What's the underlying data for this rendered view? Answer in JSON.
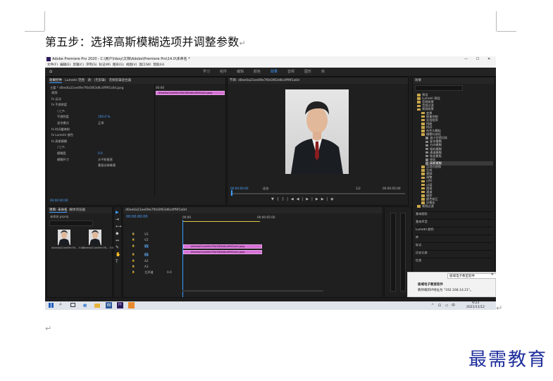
{
  "document": {
    "heading": "第五步：选择高斯模糊选项并调整参数",
    "paragraph_mark": "↵"
  },
  "premiere": {
    "title": "Adobe Premiere Pro 2020 - C:\\用户\\hboy\\文档\\Adobe\\Premiere Pro\\14.0\\未命名 *",
    "window_controls": [
      "—",
      "☐",
      "✕"
    ],
    "menu": [
      "文件(F)",
      "编辑(E)",
      "剪辑(C)",
      "序列(S)",
      "标记(M)",
      "图形(G)",
      "视图(V)",
      "窗口(W)",
      "帮助(H)"
    ],
    "workspaces": [
      "学习",
      "组件",
      "编辑",
      "颜色",
      "效果",
      "音频",
      "图形",
      "库"
    ],
    "active_workspace": "效果",
    "effect_controls": {
      "tabs": [
        "效果控件",
        "Lumetri 范围",
        "源：(无剪辑)",
        "音频剪辑混合器"
      ],
      "master_label": "主要 * d0ee0a21ee09e7f0d3f63d6c4ff9f1a0d.jpeg",
      "clip_label": "d0ee0a21ee09e7f0d3f63d6c4ff9f1a0d.jpeg",
      "timecode": "00:00",
      "rows": [
        {
          "label": "视频",
          "value": ""
        },
        {
          "label": "fx  运动",
          "value": ""
        },
        {
          "label": "fx  不透明度",
          "value": ""
        },
        {
          "label": "○□✎",
          "value": ""
        },
        {
          "label": "不透明度",
          "value": "100.0 %"
        },
        {
          "label": "混合模式",
          "value": "正常"
        },
        {
          "label": "fx  时间重映射",
          "value": ""
        },
        {
          "label": "fx  Lumetri 颜色",
          "value": ""
        },
        {
          "label": "fx  高斯模糊",
          "value": ""
        },
        {
          "label": "○□✎",
          "value": ""
        },
        {
          "label": "模糊度",
          "value": "0.0"
        },
        {
          "label": "模糊尺寸",
          "value": "水平和垂直"
        },
        {
          "label": "",
          "value": "重复边缘像素"
        }
      ],
      "bottom_time": "00:00:00:00"
    },
    "program": {
      "title": "节目: d0ee0a21ee09e7f0d3f63d6c4ff9f1a0d",
      "timecode": "00:00:00:00",
      "fit": "适合",
      "fraction": "1/2",
      "duration": "00:00:05:00"
    },
    "effects_panel": {
      "title": "效果",
      "items": [
        {
          "label": "预设",
          "level": 0
        },
        {
          "label": "Lumetri 预设",
          "level": 0
        },
        {
          "label": "音频效果",
          "level": 0
        },
        {
          "label": "音频过渡",
          "level": 0
        },
        {
          "label": "视频效果",
          "level": 0
        },
        {
          "label": "变换",
          "level": 1
        },
        {
          "label": "图像控制",
          "level": 1
        },
        {
          "label": "实用程序",
          "level": 1
        },
        {
          "label": "扭曲",
          "level": 1
        },
        {
          "label": "时间",
          "level": 1
        },
        {
          "label": "杂色与颗粒",
          "level": 1
        },
        {
          "label": "模糊与锐化",
          "level": 1
        },
        {
          "label": "减少交错闪烁",
          "level": 2
        },
        {
          "label": "复合模糊",
          "level": 2
        },
        {
          "label": "方向模糊",
          "level": 2
        },
        {
          "label": "相机模糊",
          "level": 2
        },
        {
          "label": "通道模糊",
          "level": 2
        },
        {
          "label": "钝化蒙版",
          "level": 2
        },
        {
          "label": "锐化",
          "level": 2
        },
        {
          "label": "高斯模糊",
          "level": 2,
          "selected": true
        },
        {
          "label": "沉浸式视频",
          "level": 1
        },
        {
          "label": "生成",
          "level": 1
        },
        {
          "label": "视频",
          "level": 1
        },
        {
          "label": "调整",
          "level": 1
        },
        {
          "label": "过时",
          "level": 1
        },
        {
          "label": "过渡",
          "level": 1
        },
        {
          "label": "透视",
          "level": 1
        },
        {
          "label": "通道",
          "level": 1
        },
        {
          "label": "键控",
          "level": 1
        },
        {
          "label": "颜色校正",
          "level": 1
        },
        {
          "label": "风格化",
          "level": 1
        },
        {
          "label": "视频过渡",
          "level": 0
        }
      ],
      "footer": [
        "基本图形",
        "基本声音",
        "Lumetri 颜色",
        "库",
        "标记",
        "历史记录",
        "信息"
      ]
    },
    "project": {
      "tabs": [
        "项目: 未命名",
        "媒体浏览器"
      ],
      "file": "未命名.prproj",
      "items": [
        {
          "name": "d0ee0a21ee09e7f0...",
          "dur": "5:00"
        },
        {
          "name": "d0ee0a21ee09e7f0...",
          "dur": "5:00"
        }
      ]
    },
    "timeline": {
      "title": "d0ee0a21ee09e7f0d3f63d6c4ff9f1a0d",
      "timecode": "00:00:00:00",
      "ruler": [
        "00:00",
        "00:00:05:00"
      ],
      "tracks": [
        "V3",
        "V2",
        "V1",
        "A1",
        "A2",
        "A3",
        "主声道"
      ],
      "master_value": "0.0",
      "clips": [
        {
          "label": "d0ee0a21ee09e7f0d3f63d6c4ff9f1a0d.jpeg",
          "track": "V2"
        },
        {
          "label": "d0ee0a21ee09e7f0d3f63d6c4ff9f1a0d.jpeg",
          "track": "V1"
        }
      ]
    },
    "toast": {
      "header": "极域电子教室软件",
      "title": "极域电子教室软件",
      "message": "教师端的IP地址为 \"192.168.14.21\"。"
    },
    "taskbar": {
      "time": "9:23",
      "date": "2021/11/12"
    }
  },
  "watermark": "最需教育"
}
